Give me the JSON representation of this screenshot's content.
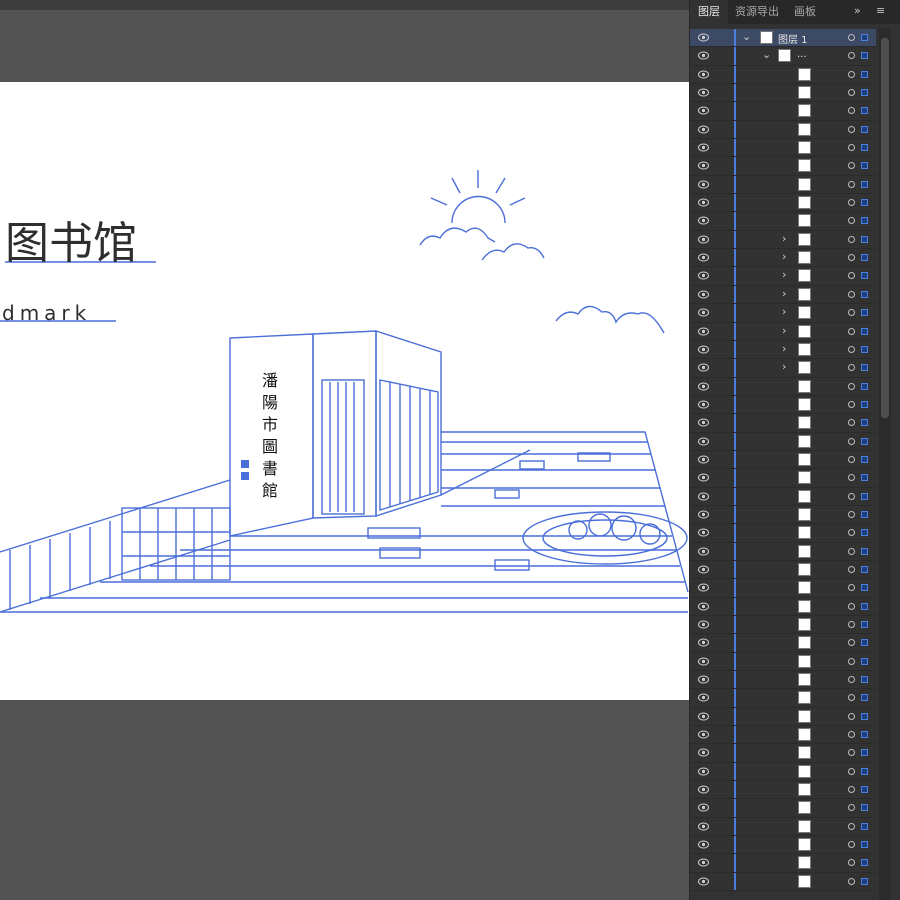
{
  "artboard": {
    "title": "图书馆",
    "subtitle": "dmark",
    "sign_text": [
      "潘",
      "陽",
      "市",
      "圖",
      "書",
      "館"
    ],
    "accent_color": "#4a6fd8"
  },
  "layers_panel": {
    "tabs": [
      {
        "label": "图层",
        "active": true
      },
      {
        "label": "资源导出",
        "active": false
      },
      {
        "label": "画板",
        "active": false
      }
    ],
    "expand_label": "»",
    "menu_label": "≡",
    "layer_name": "图层 1",
    "group_name": "...",
    "row_count": 47,
    "accent_color": "#4a7fe0"
  }
}
